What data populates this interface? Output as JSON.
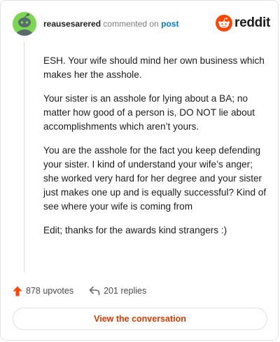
{
  "header": {
    "username": "reausesarered",
    "action_text": "commented on",
    "post_link": "post",
    "brand": "reddit"
  },
  "comment": {
    "paragraphs": [
      "ESH. Your wife should mind her own business which makes her the asshole.",
      "Your sister is an asshole for lying about a BA; no matter how good of a person is, DO NOT lie about accomplishments which aren’t yours.",
      "You are the asshole for the fact you keep defending your sister. I kind of understand your wife’s anger; she worked very hard for her degree and your sister just makes one up and is equally successful? Kind of see where your wife is coming from",
      "Edit; thanks for the awards kind strangers :)"
    ]
  },
  "footer": {
    "upvotes": "878 upvotes",
    "replies": "201 replies"
  },
  "cta": {
    "label": "View the conversation"
  },
  "colors": {
    "accent": "#d93a00",
    "upvote": "#ff4500",
    "avatar_bg": "#7bd650",
    "link": "#0079d3"
  }
}
